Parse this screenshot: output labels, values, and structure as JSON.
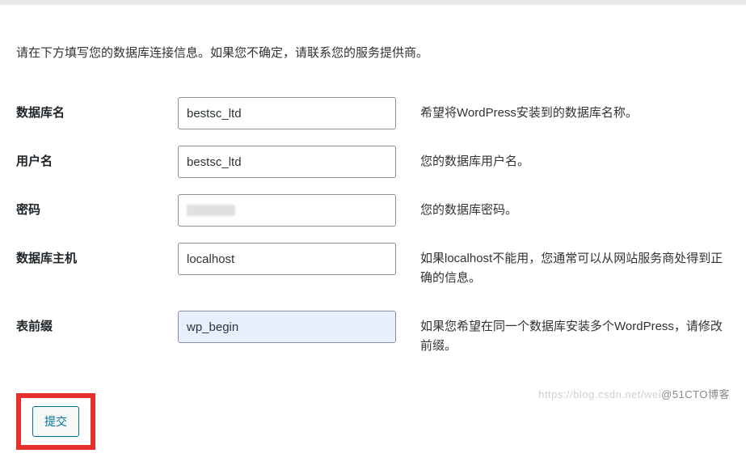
{
  "intro": "请在下方填写您的数据库连接信息。如果您不确定，请联系您的服务提供商。",
  "fields": {
    "dbname": {
      "label": "数据库名",
      "value": "bestsc_ltd",
      "desc": "希望将WordPress安装到的数据库名称。"
    },
    "username": {
      "label": "用户名",
      "value": "bestsc_ltd",
      "desc": "您的数据库用户名。"
    },
    "password": {
      "label": "密码",
      "value": "",
      "desc": "您的数据库密码。"
    },
    "dbhost": {
      "label": "数据库主机",
      "value": "localhost",
      "desc": "如果localhost不能用，您通常可以从网站服务商处得到正确的信息。"
    },
    "prefix": {
      "label": "表前缀",
      "value": "wp_begin",
      "desc": "如果您希望在同一个数据库安装多个WordPress，请修改前缀。"
    }
  },
  "submit": "提交",
  "watermark_left": "https://blog.csdn.net/wei",
  "watermark_right": "@51CTO博客"
}
